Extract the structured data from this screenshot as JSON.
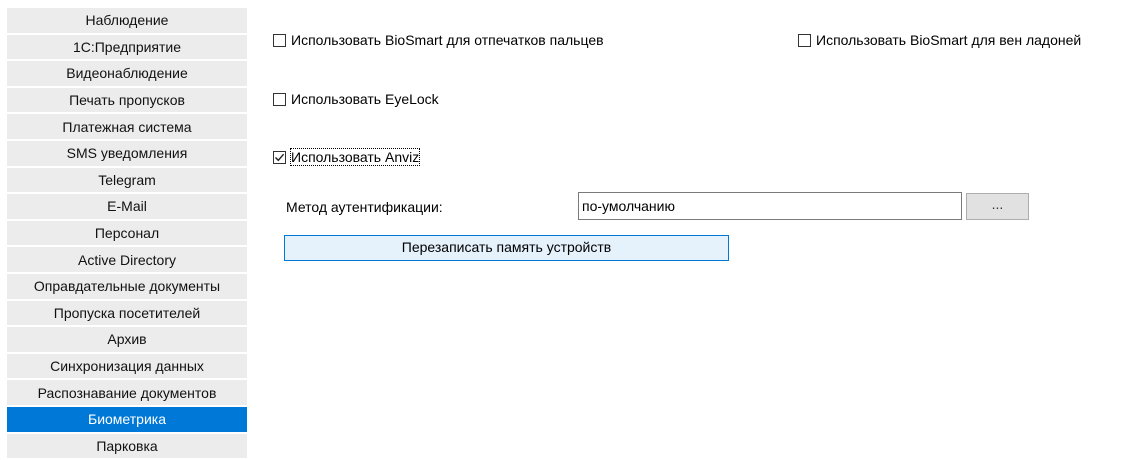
{
  "sidebar": {
    "items": [
      {
        "label": "Наблюдение",
        "active": false
      },
      {
        "label": "1С:Предприятие",
        "active": false
      },
      {
        "label": "Видеонаблюдение",
        "active": false
      },
      {
        "label": "Печать пропусков",
        "active": false
      },
      {
        "label": "Платежная система",
        "active": false
      },
      {
        "label": "SMS уведомления",
        "active": false
      },
      {
        "label": "Telegram",
        "active": false
      },
      {
        "label": "E-Mail",
        "active": false
      },
      {
        "label": "Персонал",
        "active": false
      },
      {
        "label": "Active Directory",
        "active": false
      },
      {
        "label": "Оправдательные документы",
        "active": false
      },
      {
        "label": "Пропуска посетителей",
        "active": false
      },
      {
        "label": "Архив",
        "active": false
      },
      {
        "label": "Синхронизация данных",
        "active": false
      },
      {
        "label": "Распознавание документов",
        "active": false
      },
      {
        "label": "Биометрика",
        "active": true
      },
      {
        "label": "Парковка",
        "active": false
      }
    ]
  },
  "options": {
    "biosmart_fingerprint": {
      "label": "Использовать BioSmart для отпечатков пальцев",
      "checked": false
    },
    "biosmart_palm": {
      "label": "Использовать BioSmart для вен ладоней",
      "checked": false
    },
    "eyelock": {
      "label": "Использовать EyeLock",
      "checked": false
    },
    "anviz": {
      "label": "Использовать Anviz",
      "checked": true
    }
  },
  "auth": {
    "label": "Метод аутентификации:",
    "value": "по-умолчанию",
    "browse_label": "..."
  },
  "rewrite_button": {
    "label": "Перезаписать память устройств"
  },
  "colors": {
    "active_nav": "#0078d7",
    "nav_bg": "#ececec",
    "primary_button_bg": "#e5f1fb"
  }
}
